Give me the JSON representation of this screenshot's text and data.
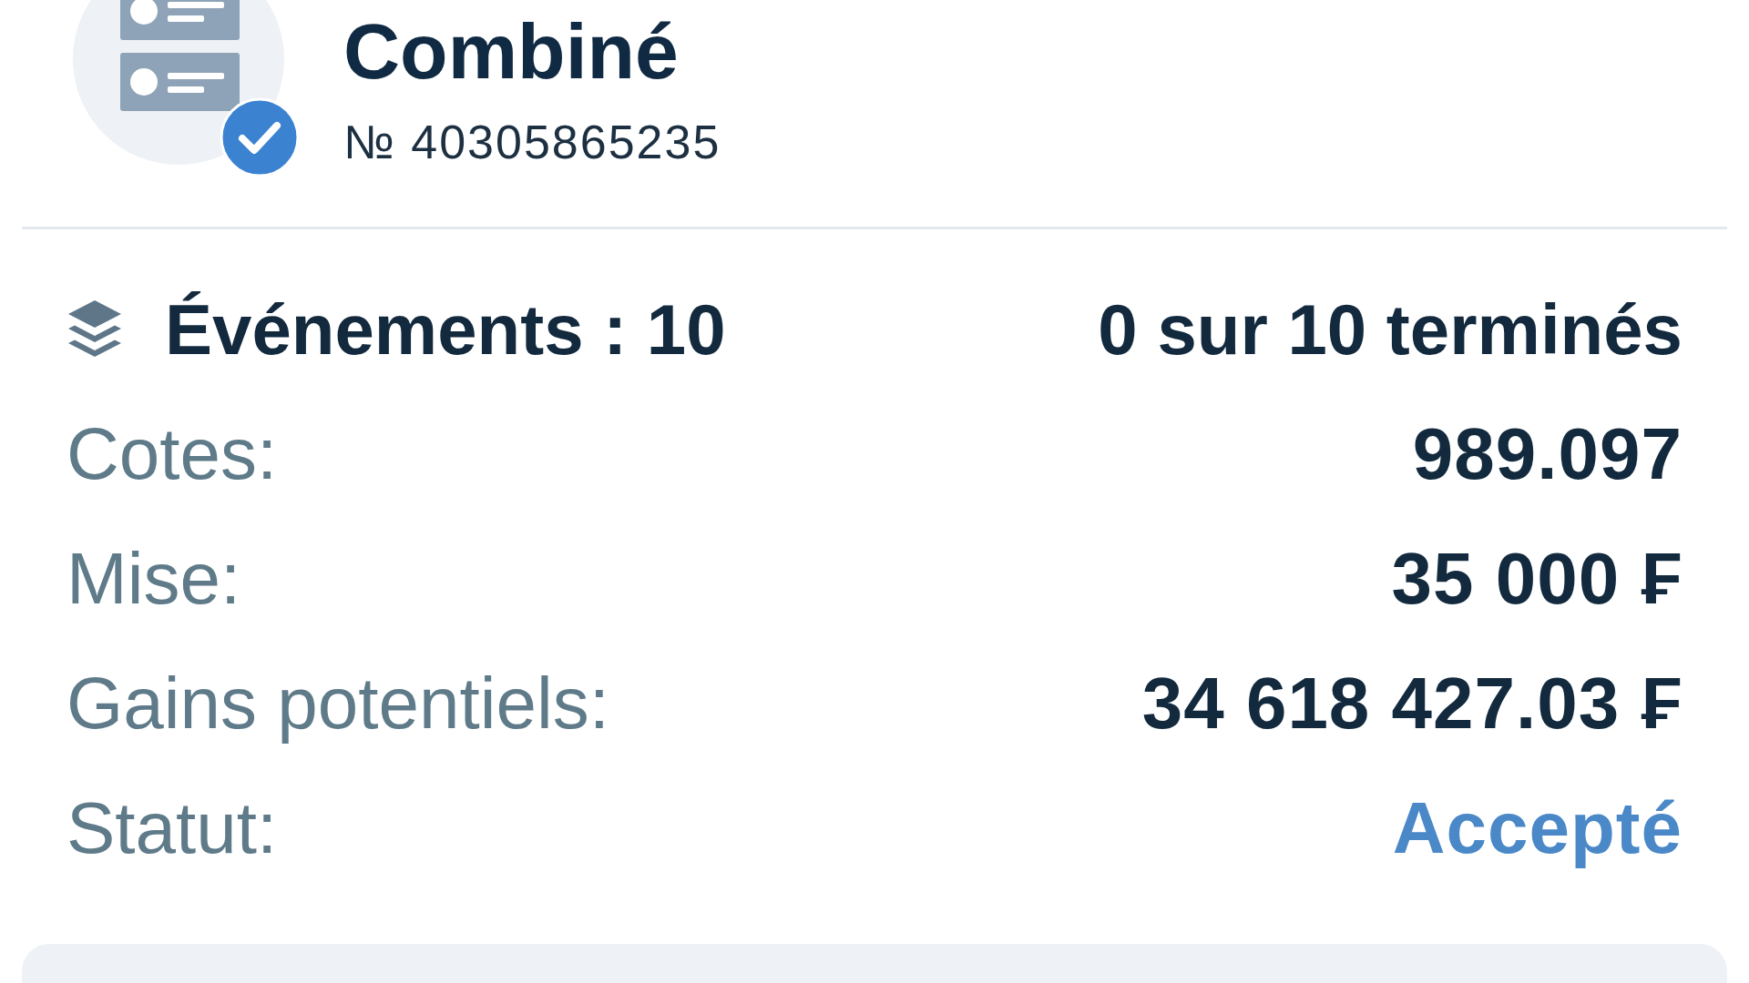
{
  "ticket": {
    "title": "Combiné",
    "number": "№ 40305865235"
  },
  "events": {
    "label": "Événements : 10",
    "progress": "0 sur 10 terminés"
  },
  "details": [
    {
      "kind": "amount",
      "label": "Cotes:",
      "value": "989.097"
    },
    {
      "kind": "amount",
      "label": "Mise:",
      "value": "35 000 ₣"
    },
    {
      "kind": "amount",
      "label": "Gains potentiels:",
      "value": "34 618 427.03 ₣"
    },
    {
      "kind": "status",
      "label": "Statut:",
      "value": "Accepté"
    }
  ]
}
